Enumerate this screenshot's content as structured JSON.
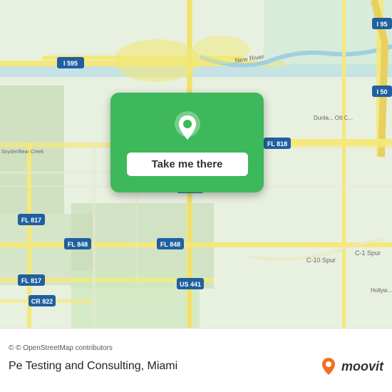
{
  "map": {
    "alt": "Map of Miami area showing Pe Testing and Consulting location"
  },
  "card": {
    "button_label": "Take me there"
  },
  "bottom_bar": {
    "attribution": "© OpenStreetMap contributors",
    "business_name": "Pe Testing and Consulting,",
    "city": "Miami",
    "moovit_label": "moovit"
  }
}
